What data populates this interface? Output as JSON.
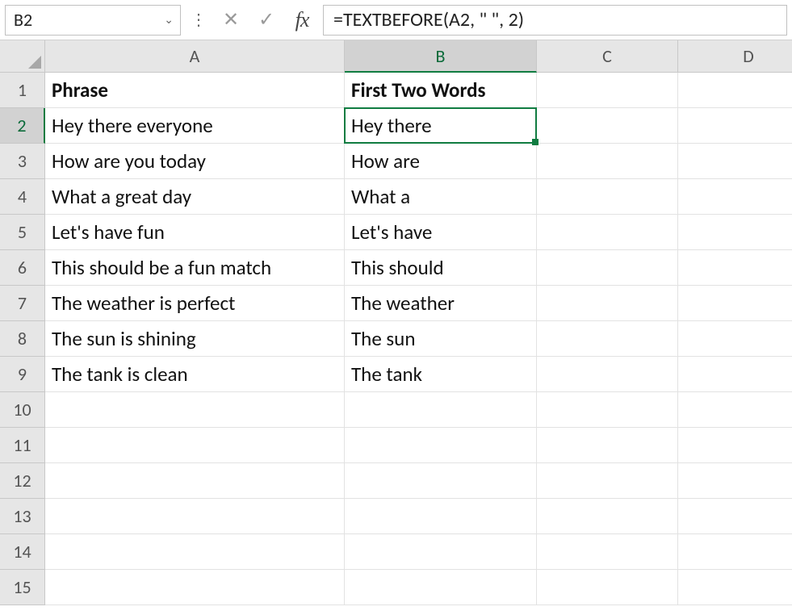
{
  "nameBox": "B2",
  "formula": "=TEXTBEFORE(A2, \" \", 2)",
  "columns": [
    "A",
    "B",
    "C",
    "D"
  ],
  "activeColumn": "B",
  "rowNumbers": [
    1,
    2,
    3,
    4,
    5,
    6,
    7,
    8,
    9,
    10,
    11,
    12,
    13,
    14,
    15
  ],
  "activeRow": 2,
  "activeCell": "B2",
  "headers": {
    "A": "Phrase",
    "B": "First Two Words"
  },
  "data": [
    {
      "A": "Hey there everyone",
      "B": "Hey there"
    },
    {
      "A": "How are you today",
      "B": "How are"
    },
    {
      "A": "What a great day",
      "B": "What a"
    },
    {
      "A": "Let's have fun",
      "B": "Let's have"
    },
    {
      "A": "This should be a fun match",
      "B": "This should"
    },
    {
      "A": "The weather is perfect",
      "B": "The weather"
    },
    {
      "A": "The sun is shining",
      "B": "The sun"
    },
    {
      "A": "The tank is clean",
      "B": "The tank"
    }
  ],
  "icons": {
    "dropdown": "⌄",
    "vdots": "⋮",
    "cancel": "✕",
    "enter": "✓",
    "fx": "fx"
  }
}
